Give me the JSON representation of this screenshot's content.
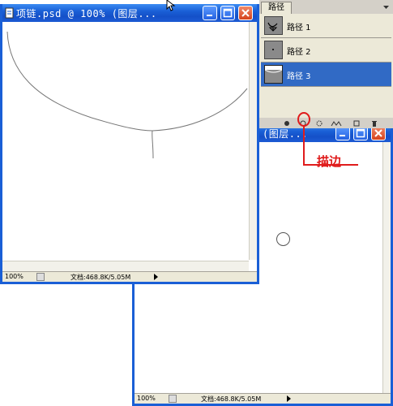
{
  "window_main": {
    "title": "项链.psd @ 100% (图层...",
    "zoom": "100%",
    "doc_info": "文档:468.8K/5.05M"
  },
  "window_second": {
    "title": "(图层...",
    "zoom": "100%",
    "doc_info": "文档:468.8K/5.05M"
  },
  "paths_panel": {
    "tab_label": "路径",
    "items": [
      {
        "label": "路径 1",
        "selected": false
      },
      {
        "label": "路径 2",
        "selected": false
      },
      {
        "label": "路径 3",
        "selected": true
      }
    ],
    "toolbar_icons": [
      "fill-path-icon",
      "stroke-path-icon",
      "load-selection-icon",
      "make-work-path-icon",
      "new-path-icon",
      "delete-path-icon"
    ]
  },
  "annotation": {
    "label": "描边",
    "color": "#e01c1c"
  },
  "colors": {
    "title_blue": "#1a5fd6",
    "selection_blue": "#316ac5",
    "panel_gray": "#d4d0c8"
  }
}
